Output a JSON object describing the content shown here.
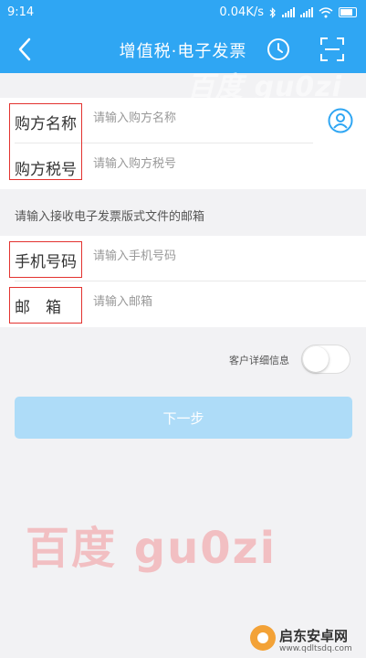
{
  "status_bar": {
    "time": "9:14",
    "speed": "0.04K/s"
  },
  "header": {
    "title": "增值税·电子发票",
    "watermark": "百度 gu0zi"
  },
  "form": {
    "buyer_name": {
      "label": "购方名称",
      "placeholder": "请输入购方名称"
    },
    "buyer_tax_id": {
      "label": "购方税号",
      "placeholder": "请输入购方税号"
    },
    "email_tip": "请输入接收电子发票版式文件的邮箱",
    "phone": {
      "label": "手机号码",
      "placeholder": "请输入手机号码"
    },
    "email": {
      "label": "邮　箱",
      "placeholder": "请输入邮箱"
    },
    "details": {
      "label": "客户详细信息",
      "enabled": false
    },
    "next_button": "下一步"
  },
  "watermark_big": "百度  gu0zi",
  "site_logo": {
    "name": "启东安卓网",
    "url": "www.qdltsdq.com"
  },
  "colors": {
    "primary": "#2fa6f3",
    "button_disabled": "#aedcf8",
    "highlight_box": "#e3322f"
  }
}
